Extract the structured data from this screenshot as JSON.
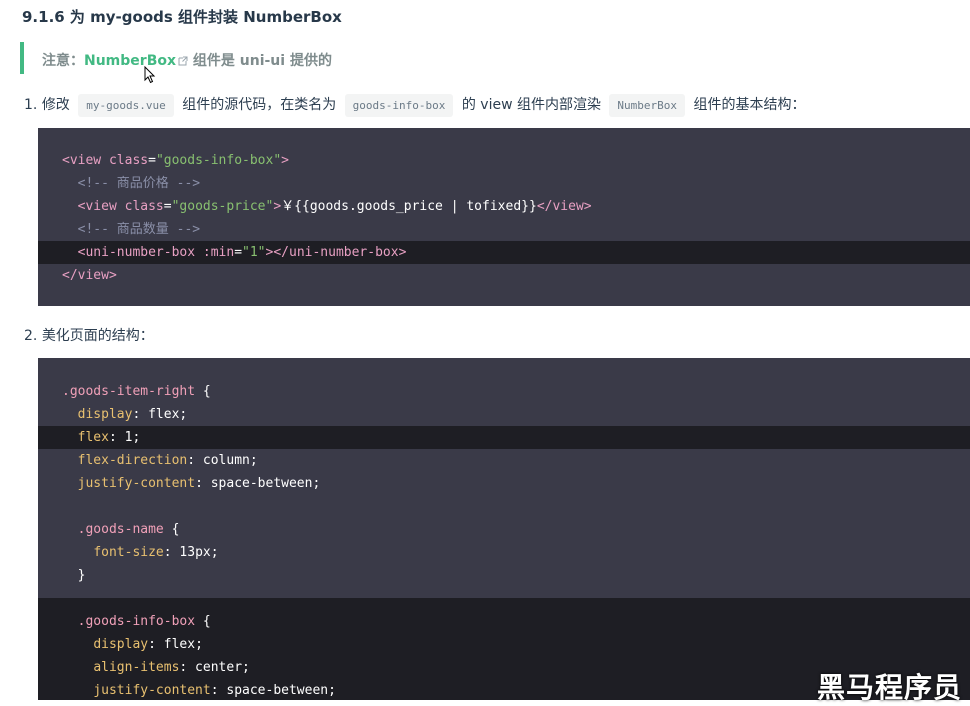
{
  "heading": "9.1.6 为 my-goods 组件封装 NumberBox",
  "note": {
    "prefix": "注意：",
    "link": "NumberBox",
    "suffix": " 组件是 uni-ui 提供的"
  },
  "step1": {
    "num": "1.",
    "t1": "修改",
    "code1": "my-goods.vue",
    "t2": "组件的源代码，在类名为",
    "code2": "goods-info-box",
    "t3": "的 view 组件内部渲染",
    "code3": "NumberBox",
    "t4": "组件的基本结构："
  },
  "code1_lines": [
    {
      "indent": "",
      "parts": [
        [
          "tag",
          "<view "
        ],
        [
          "attr",
          "class"
        ],
        [
          "plain",
          "="
        ],
        [
          "str",
          "\"goods-info-box\""
        ],
        [
          "tag",
          ">"
        ]
      ]
    },
    {
      "indent": "  ",
      "parts": [
        [
          "cmt",
          "<!-- 商品价格 -->"
        ]
      ]
    },
    {
      "indent": "  ",
      "parts": [
        [
          "tag",
          "<view "
        ],
        [
          "attr",
          "class"
        ],
        [
          "plain",
          "="
        ],
        [
          "str",
          "\"goods-price\""
        ],
        [
          "tag",
          ">"
        ],
        [
          "plain",
          "￥{{goods.goods_price | tofixed}}"
        ],
        [
          "tag",
          "</view>"
        ]
      ]
    },
    {
      "indent": "  ",
      "parts": [
        [
          "cmt",
          "<!-- 商品数量 -->"
        ]
      ]
    },
    {
      "indent": "  ",
      "parts": [
        [
          "tag",
          "<uni-number-box "
        ],
        [
          "attr",
          ":min"
        ],
        [
          "plain",
          "="
        ],
        [
          "str",
          "\"1\""
        ],
        [
          "tag",
          "></uni-number-box>"
        ]
      ]
    },
    {
      "indent": "",
      "parts": [
        [
          "tag",
          "</view>"
        ]
      ]
    }
  ],
  "step2": {
    "num": "2.",
    "text": "美化页面的结构："
  },
  "code2_lines": [
    {
      "indent": "",
      "parts": [
        [
          "sel",
          ".goods-item-right"
        ],
        [
          "plain",
          " {"
        ]
      ]
    },
    {
      "indent": "  ",
      "parts": [
        [
          "prop",
          "display"
        ],
        [
          "plain",
          ": flex;"
        ]
      ]
    },
    {
      "indent": "  ",
      "parts": [
        [
          "prop",
          "flex"
        ],
        [
          "plain",
          ": 1;"
        ]
      ]
    },
    {
      "indent": "  ",
      "parts": [
        [
          "prop",
          "flex-direction"
        ],
        [
          "plain",
          ": column;"
        ]
      ]
    },
    {
      "indent": "  ",
      "parts": [
        [
          "prop",
          "justify-content"
        ],
        [
          "plain",
          ": space-between;"
        ]
      ]
    },
    {
      "indent": "",
      "parts": []
    },
    {
      "indent": "  ",
      "parts": [
        [
          "sel",
          ".goods-name"
        ],
        [
          "plain",
          " {"
        ]
      ]
    },
    {
      "indent": "    ",
      "parts": [
        [
          "prop",
          "font-size"
        ],
        [
          "plain",
          ": 13px;"
        ]
      ]
    },
    {
      "indent": "  ",
      "parts": [
        [
          "plain",
          "}"
        ]
      ]
    },
    {
      "indent": "",
      "parts": []
    },
    {
      "indent": "  ",
      "parts": [
        [
          "sel",
          ".goods-info-box"
        ],
        [
          "plain",
          " {"
        ]
      ]
    },
    {
      "indent": "    ",
      "parts": [
        [
          "prop",
          "display"
        ],
        [
          "plain",
          ": flex;"
        ]
      ]
    },
    {
      "indent": "    ",
      "parts": [
        [
          "prop",
          "align-items"
        ],
        [
          "plain",
          ": center;"
        ]
      ]
    },
    {
      "indent": "    ",
      "parts": [
        [
          "prop",
          "justify-content"
        ],
        [
          "plain",
          ": space-between;"
        ]
      ]
    }
  ],
  "watermark": "黑马程序员",
  "colors": {
    "accent": "#42b983",
    "code_bg": "#3a3a48",
    "code_highlight": "#1e1e24"
  }
}
